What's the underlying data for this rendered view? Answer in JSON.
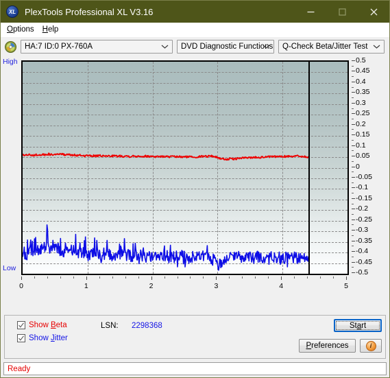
{
  "window": {
    "title": "PlexTools Professional XL V3.16",
    "icon": "XL",
    "icon_name": "plextools-logo-icon",
    "titlebar_color": "#4e5519",
    "controls": {
      "minimize": "minimize-icon",
      "maximize": "maximize-icon",
      "close": "close-icon"
    }
  },
  "menubar": {
    "items": [
      {
        "label": "Options",
        "mnemonic": "O",
        "rest": "ptions"
      },
      {
        "label": "Help",
        "mnemonic": "H",
        "rest": "elp"
      }
    ]
  },
  "toolbar": {
    "disc_icon": "optical-disc-icon",
    "drive_select": {
      "value": "HA:7 ID:0  PX-760A",
      "options": [
        "HA:7 ID:0  PX-760A"
      ]
    },
    "function_select": {
      "value": "DVD Diagnostic Functions",
      "options": [
        "DVD Diagnostic Functions"
      ]
    },
    "test_select": {
      "value": "Q-Check Beta/Jitter Test",
      "options": [
        "Q-Check Beta/Jitter Test"
      ]
    }
  },
  "chart_labels": {
    "high": "High",
    "low": "Low"
  },
  "controls": {
    "show_beta": {
      "label_pre": "Show ",
      "mnemonic": "B",
      "label_post": "eta",
      "checked": true,
      "color": "#e60000"
    },
    "show_jitter": {
      "label_pre": "Show ",
      "mnemonic": "J",
      "label_post": "itter",
      "checked": true,
      "color": "#1414e6"
    },
    "lsn_label": "LSN:",
    "lsn_value": "2298368",
    "start_button": {
      "pre": "St",
      "mnemonic": "a",
      "post": "rt"
    },
    "preferences_button": {
      "pre": "",
      "mnemonic": "P",
      "post": "references"
    },
    "info_button": {
      "glyph": "i",
      "name": "info-icon"
    }
  },
  "statusbar": {
    "text": "Ready"
  },
  "chart_data": {
    "type": "line",
    "title": "Q-Check Beta/Jitter Test",
    "xlabel": "",
    "ylabel": "",
    "xlim": [
      0,
      5
    ],
    "ylim": [
      -0.5,
      0.5
    ],
    "grid": true,
    "legend": "none",
    "x_ticks": [
      0,
      1,
      2,
      3,
      4,
      5
    ],
    "x_tick_labels": [
      "0",
      "1",
      "2",
      "3",
      "4",
      "5"
    ],
    "y_ticks": [
      0.5,
      0.45,
      0.4,
      0.35,
      0.3,
      0.25,
      0.2,
      0.15,
      0.1,
      0.05,
      0,
      -0.05,
      -0.1,
      -0.15,
      -0.2,
      -0.25,
      -0.3,
      -0.35,
      -0.4,
      -0.45,
      -0.5
    ],
    "y_tick_labels": [
      "0.5",
      "0.45",
      "0.4",
      "0.35",
      "0.3",
      "0.25",
      "0.2",
      "0.15",
      "0.1",
      "0.05",
      "0",
      "-0.05",
      "-0.1",
      "-0.15",
      "-0.2",
      "-0.25",
      "-0.3",
      "-0.35",
      "-0.4",
      "-0.45",
      "-0.5"
    ],
    "data_end_x": 4.4,
    "annotations": [
      {
        "type": "vertical-line",
        "x": 4.4,
        "label": "end-of-data marker",
        "color": "#000000"
      }
    ],
    "series": [
      {
        "name": "Beta",
        "color": "#ee0000",
        "axis": "left",
        "x": [
          0.0,
          0.05,
          0.1,
          0.15,
          0.2,
          0.25,
          0.3,
          0.35,
          0.4,
          0.45,
          0.5,
          0.55,
          0.6,
          0.65,
          0.7,
          0.75,
          0.8,
          0.85,
          0.9,
          0.95,
          1.0,
          1.05,
          1.1,
          1.15,
          1.2,
          1.25,
          1.3,
          1.35,
          1.4,
          1.45,
          1.5,
          1.55,
          1.6,
          1.65,
          1.7,
          1.75,
          1.8,
          1.85,
          1.9,
          1.95,
          2.0,
          2.05,
          2.1,
          2.15,
          2.2,
          2.25,
          2.3,
          2.35,
          2.4,
          2.45,
          2.5,
          2.55,
          2.6,
          2.65,
          2.7,
          2.75,
          2.8,
          2.85,
          2.9,
          2.95,
          3.0,
          3.05,
          3.1,
          3.15,
          3.2,
          3.25,
          3.3,
          3.35,
          3.4,
          3.45,
          3.5,
          3.55,
          3.6,
          3.65,
          3.7,
          3.75,
          3.8,
          3.85,
          3.9,
          3.95,
          4.0,
          4.05,
          4.1,
          4.15,
          4.2,
          4.25,
          4.3,
          4.35,
          4.4
        ],
        "values": [
          0.06,
          0.059,
          0.061,
          0.058,
          0.062,
          0.06,
          0.063,
          0.059,
          0.064,
          0.061,
          0.066,
          0.062,
          0.065,
          0.06,
          0.063,
          0.059,
          0.06,
          0.057,
          0.059,
          0.056,
          0.058,
          0.055,
          0.057,
          0.055,
          0.057,
          0.054,
          0.056,
          0.055,
          0.057,
          0.054,
          0.056,
          0.054,
          0.056,
          0.053,
          0.055,
          0.054,
          0.056,
          0.053,
          0.055,
          0.053,
          0.055,
          0.052,
          0.054,
          0.052,
          0.054,
          0.051,
          0.053,
          0.051,
          0.053,
          0.05,
          0.052,
          0.051,
          0.053,
          0.05,
          0.052,
          0.053,
          0.055,
          0.054,
          0.056,
          0.053,
          0.048,
          0.043,
          0.041,
          0.04,
          0.042,
          0.041,
          0.043,
          0.045,
          0.047,
          0.046,
          0.049,
          0.048,
          0.05,
          0.049,
          0.051,
          0.05,
          0.052,
          0.051,
          0.053,
          0.052,
          0.054,
          0.053,
          0.055,
          0.054,
          0.056,
          0.055,
          0.054,
          0.052,
          0.048
        ],
        "mean": 0.055
      },
      {
        "name": "Jitter",
        "color": "#0d0de6",
        "axis": "left",
        "x": [
          0.0,
          0.05,
          0.1,
          0.15,
          0.2,
          0.25,
          0.3,
          0.35,
          0.4,
          0.45,
          0.5,
          0.55,
          0.6,
          0.65,
          0.7,
          0.75,
          0.8,
          0.85,
          0.9,
          0.95,
          1.0,
          1.05,
          1.1,
          1.15,
          1.2,
          1.25,
          1.3,
          1.35,
          1.4,
          1.45,
          1.5,
          1.55,
          1.6,
          1.65,
          1.7,
          1.75,
          1.8,
          1.85,
          1.9,
          1.95,
          2.0,
          2.05,
          2.1,
          2.15,
          2.2,
          2.25,
          2.3,
          2.35,
          2.4,
          2.45,
          2.5,
          2.55,
          2.6,
          2.65,
          2.7,
          2.75,
          2.8,
          2.85,
          2.9,
          2.95,
          3.0,
          3.05,
          3.1,
          3.15,
          3.2,
          3.25,
          3.3,
          3.35,
          3.4,
          3.45,
          3.5,
          3.55,
          3.6,
          3.65,
          3.7,
          3.75,
          3.8,
          3.85,
          3.9,
          3.95,
          4.0,
          4.05,
          4.1,
          4.15,
          4.2,
          4.25,
          4.3,
          4.35,
          4.4
        ],
        "values": [
          -0.415,
          -0.408,
          -0.4,
          -0.396,
          -0.402,
          -0.388,
          -0.38,
          -0.372,
          -0.384,
          -0.392,
          -0.376,
          -0.386,
          -0.398,
          -0.39,
          -0.402,
          -0.396,
          -0.406,
          -0.398,
          -0.41,
          -0.404,
          -0.412,
          -0.4,
          -0.408,
          -0.402,
          -0.41,
          -0.405,
          -0.412,
          -0.406,
          -0.414,
          -0.408,
          -0.415,
          -0.41,
          -0.416,
          -0.411,
          -0.417,
          -0.412,
          -0.418,
          -0.413,
          -0.419,
          -0.414,
          -0.418,
          -0.415,
          -0.419,
          -0.416,
          -0.42,
          -0.417,
          -0.421,
          -0.418,
          -0.42,
          -0.417,
          -0.421,
          -0.418,
          -0.422,
          -0.419,
          -0.423,
          -0.42,
          -0.424,
          -0.421,
          -0.428,
          -0.436,
          -0.448,
          -0.442,
          -0.434,
          -0.426,
          -0.42,
          -0.418,
          -0.422,
          -0.419,
          -0.423,
          -0.42,
          -0.424,
          -0.421,
          -0.425,
          -0.422,
          -0.426,
          -0.423,
          -0.427,
          -0.424,
          -0.428,
          -0.425,
          -0.429,
          -0.426,
          -0.43,
          -0.427,
          -0.431,
          -0.428,
          -0.424,
          -0.42,
          -0.418
        ],
        "mean": -0.415
      }
    ]
  }
}
